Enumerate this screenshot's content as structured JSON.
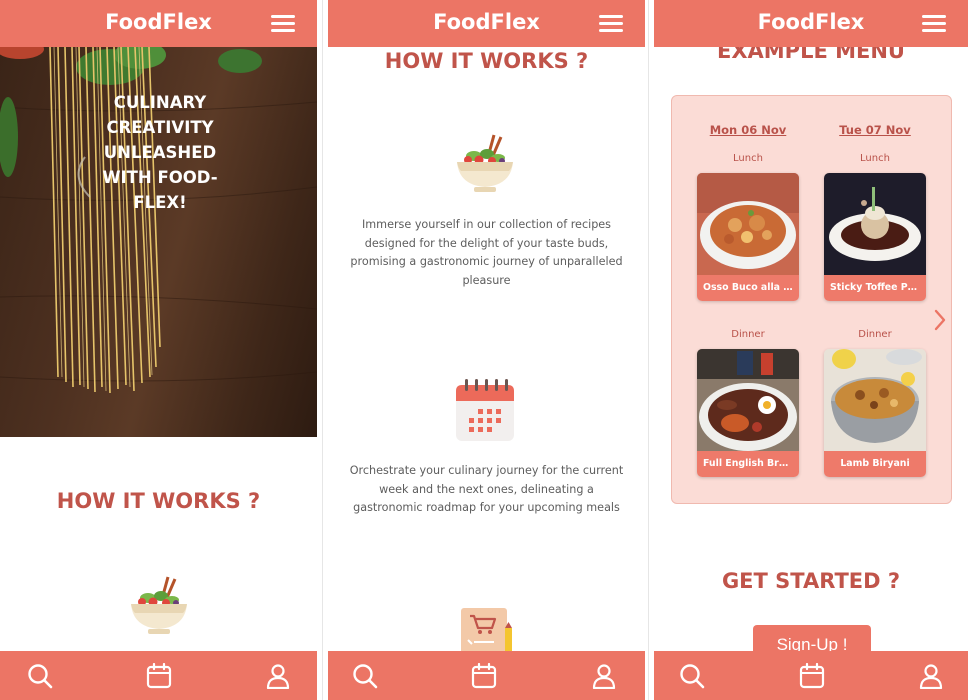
{
  "app": {
    "brand": "FoodFlex"
  },
  "screen1": {
    "hero_title": "CULINARY CREATIVITY UNLEASHED WITH FOOD-FLEX!",
    "section_title": "HOW IT WORKS ?"
  },
  "screen2": {
    "section_title": "HOW IT WORKS ?",
    "step1_text": "Immerse yourself in our collection of recipes designed for the delight of your taste buds, promising a gastronomic journey of unparalleled pleasure",
    "step2_text": "Orchestrate your culinary journey for the current week and the next ones, delineating a gastronomic roadmap for your upcoming meals"
  },
  "screen3": {
    "section_title": "EXAMPLE MENU",
    "days": [
      {
        "label": "Mon 06 Nov",
        "lunch": "Lunch",
        "lunch_dish": "Osso Buco alla ...",
        "dinner": "Dinner",
        "dinner_dish": "Full English Brea..."
      },
      {
        "label": "Tue 07 Nov",
        "lunch": "Lunch",
        "lunch_dish": "Sticky Toffee Pu...",
        "dinner": "Dinner",
        "dinner_dish": "Lamb Biryani"
      }
    ],
    "get_started_title": "GET STARTED ?",
    "signup_label": "Sign-Up !"
  },
  "icons": {
    "menu": "hamburger-icon",
    "search": "search-icon",
    "calendar": "calendar-icon",
    "profile": "user-icon",
    "next": "chevron-right-icon"
  },
  "colors": {
    "primary": "#ec7565",
    "title": "#c0544a",
    "card_bg": "#fbdcd6",
    "text": "#5d5d5d"
  }
}
